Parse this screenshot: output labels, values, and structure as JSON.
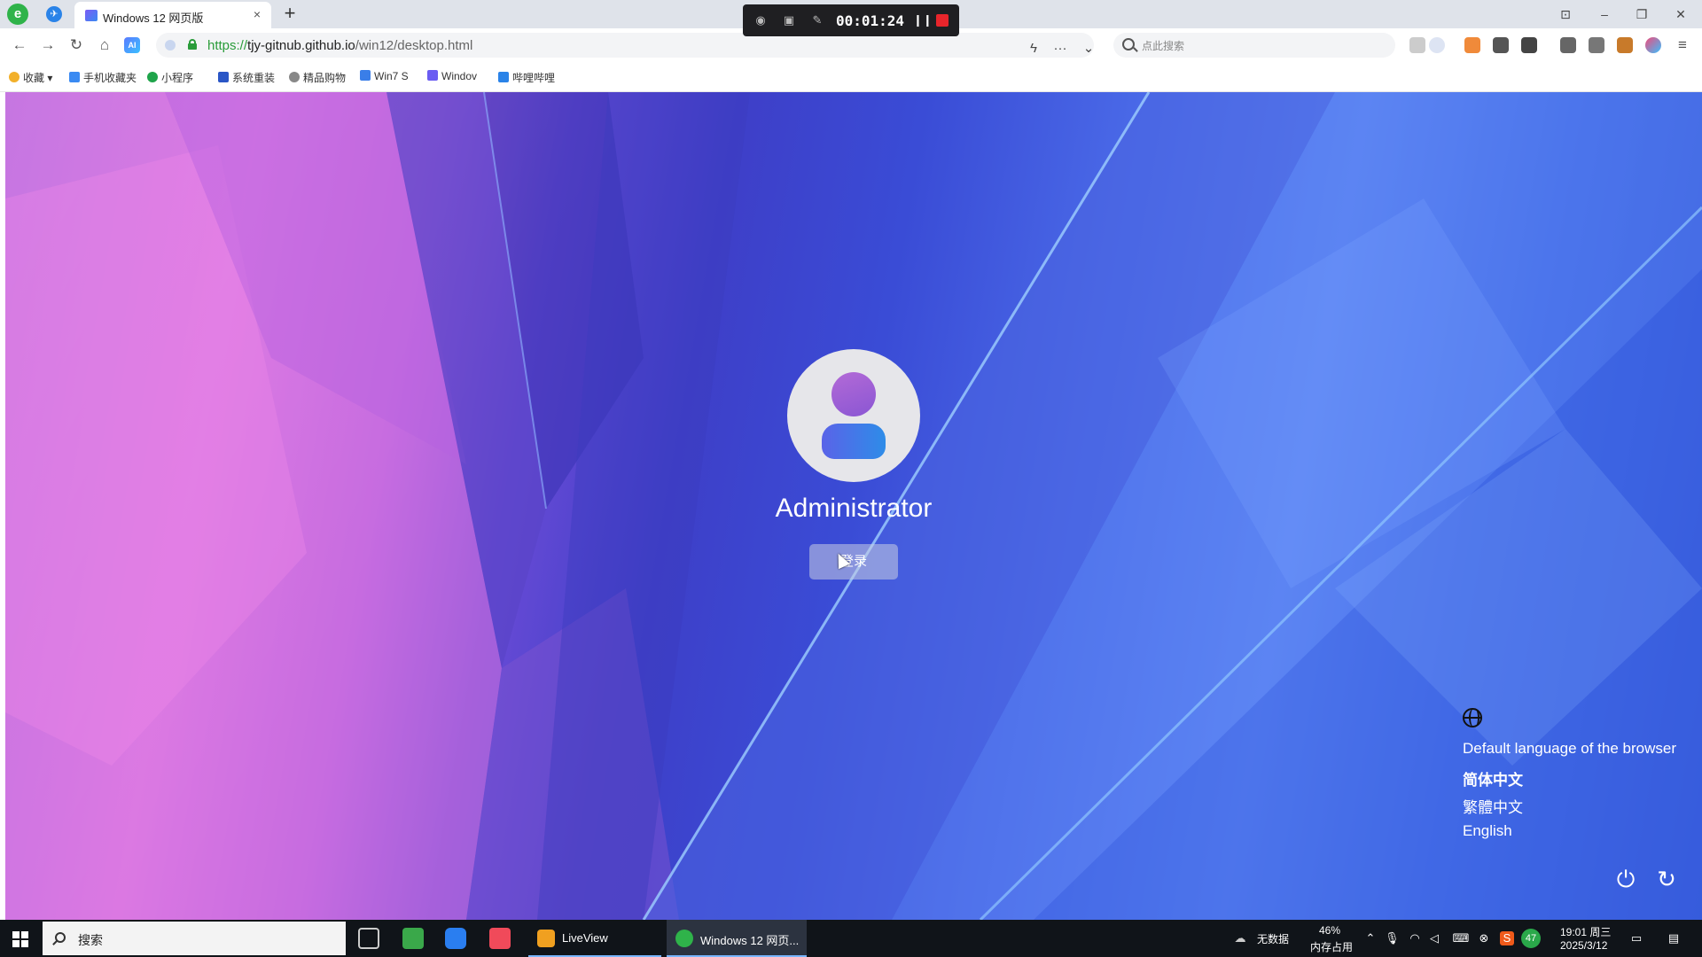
{
  "browser": {
    "tab_title": "Windows 12 网页版",
    "tab_close": "×",
    "new_tab": "+",
    "url_scheme": "https://",
    "url_host": "tjy-gitnub.github.io",
    "url_path": "/win12/desktop.html",
    "search_placeholder": "点此搜索",
    "nav": {
      "back": "←",
      "forward": "→",
      "reload": "↻",
      "home": "⌂",
      "ai": "AI"
    },
    "window_controls": {
      "minimize": "–",
      "restore": "❐",
      "close": "✕"
    }
  },
  "recorder": {
    "time": "00:01:24"
  },
  "bookmarks": [
    {
      "label": "收藏",
      "color": "#f2b02a"
    },
    {
      "label": "手机收藏夹",
      "color": "#3a8af2"
    },
    {
      "label": "小程序",
      "color": "#1fa44a"
    },
    {
      "label": "系统重装",
      "color": "#2a56c6"
    },
    {
      "label": "精品购物",
      "color": "#888888"
    },
    {
      "label": "Win7 S",
      "color": "#3a7ee8"
    },
    {
      "label": "Windov",
      "color": "#6a5cf2"
    },
    {
      "label": "哔哩哔哩",
      "color": "#2a83e8"
    }
  ],
  "lockscreen": {
    "username": "Administrator",
    "login_button": "登录",
    "languages": [
      {
        "label": "Default language of the browser",
        "active": false
      },
      {
        "label": "简体中文",
        "active": true
      },
      {
        "label": "繁體中文",
        "active": false
      },
      {
        "label": "English",
        "active": false
      }
    ],
    "power_icon": "⏻",
    "restart_icon": "↻"
  },
  "taskbar": {
    "search_text": "搜索",
    "apps": [
      {
        "label": "LiveView",
        "color": "#f0a020"
      },
      {
        "label": "Windows 12 网页...",
        "color": "#2fb34a"
      }
    ],
    "weather": "无数据",
    "memory_percent": "46%",
    "memory_label": "内存占用",
    "time": "19:01 周三",
    "date": "2025/3/12",
    "badge": "47"
  },
  "colors": {
    "accent": "#3a8af2",
    "taskbar_bg": "#101419"
  }
}
